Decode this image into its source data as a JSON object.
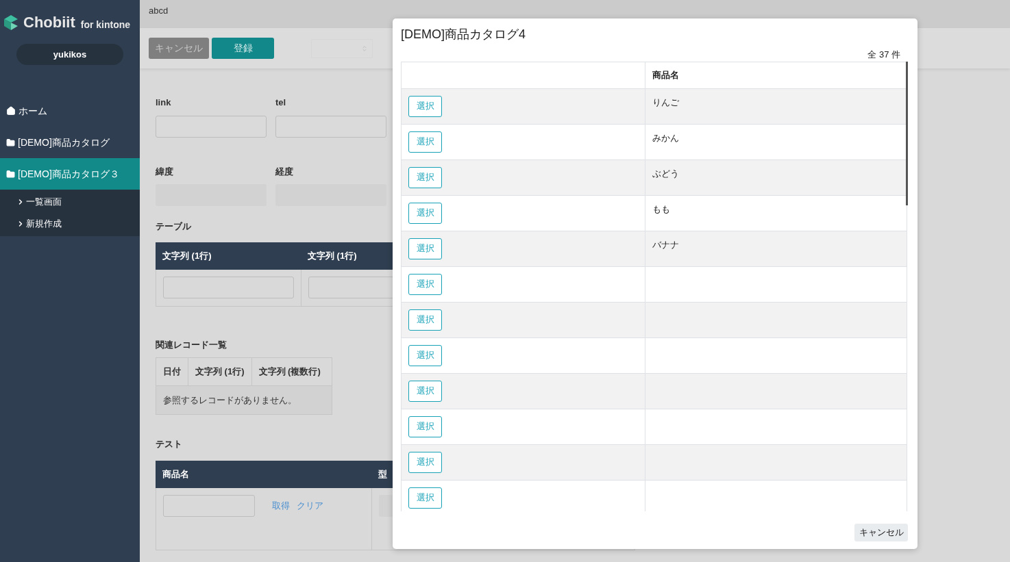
{
  "sidebar": {
    "logo": {
      "name": "Chobiit",
      "suffix": "for kintone"
    },
    "user": "yukikos",
    "items": [
      {
        "kind": "home",
        "label": "ホーム",
        "selected": false
      },
      {
        "kind": "folder",
        "label": "[DEMO]商品カタログ",
        "selected": false
      },
      {
        "kind": "folder",
        "label": "[DEMO]商品カタログ３",
        "selected": true,
        "children": [
          {
            "label": "一覧画面"
          },
          {
            "label": "新規作成"
          }
        ]
      }
    ]
  },
  "header": {
    "title": "abcd"
  },
  "toolbar": {
    "buttons": [
      {
        "label": "キャンセル",
        "kind": "secondary"
      },
      {
        "label": "登録",
        "kind": "primary"
      }
    ]
  },
  "form": {
    "fields": [
      {
        "label": "link",
        "disabled": false
      },
      {
        "label": "tel",
        "disabled": false
      },
      {
        "label": "緯度",
        "disabled": true
      },
      {
        "label": "経度",
        "disabled": true
      }
    ],
    "table": {
      "title": "テーブル",
      "columns": [
        "文字列 (1行)",
        "文字列 (1行)"
      ]
    },
    "related": {
      "title": "関連レコード一覧",
      "columns": [
        "日付",
        "文字列 (1行)",
        "文字列 (複数行)"
      ],
      "empty": "参照するレコードがありません。"
    },
    "lookup_table": {
      "title": "テスト",
      "columns": [
        "商品名",
        "型"
      ],
      "links": [
        "取得",
        "クリア"
      ]
    }
  },
  "modal": {
    "title": "[DEMO]商品カタログ4",
    "count": "全 37 件",
    "name_column": "商品名",
    "rows": [
      {
        "button": "選択",
        "name": "りんご"
      },
      {
        "button": "選択",
        "name": "みかん"
      },
      {
        "button": "選択",
        "name": "ぶどう"
      },
      {
        "button": "選択",
        "name": "もも"
      },
      {
        "button": "選択",
        "name": "バナナ"
      },
      {
        "button": "選択"
      },
      {
        "button": "選択"
      },
      {
        "button": "選択"
      },
      {
        "button": "選択"
      },
      {
        "button": "選択"
      },
      {
        "button": "選択"
      },
      {
        "button": "選択"
      }
    ],
    "footer_button": "キャンセル"
  }
}
